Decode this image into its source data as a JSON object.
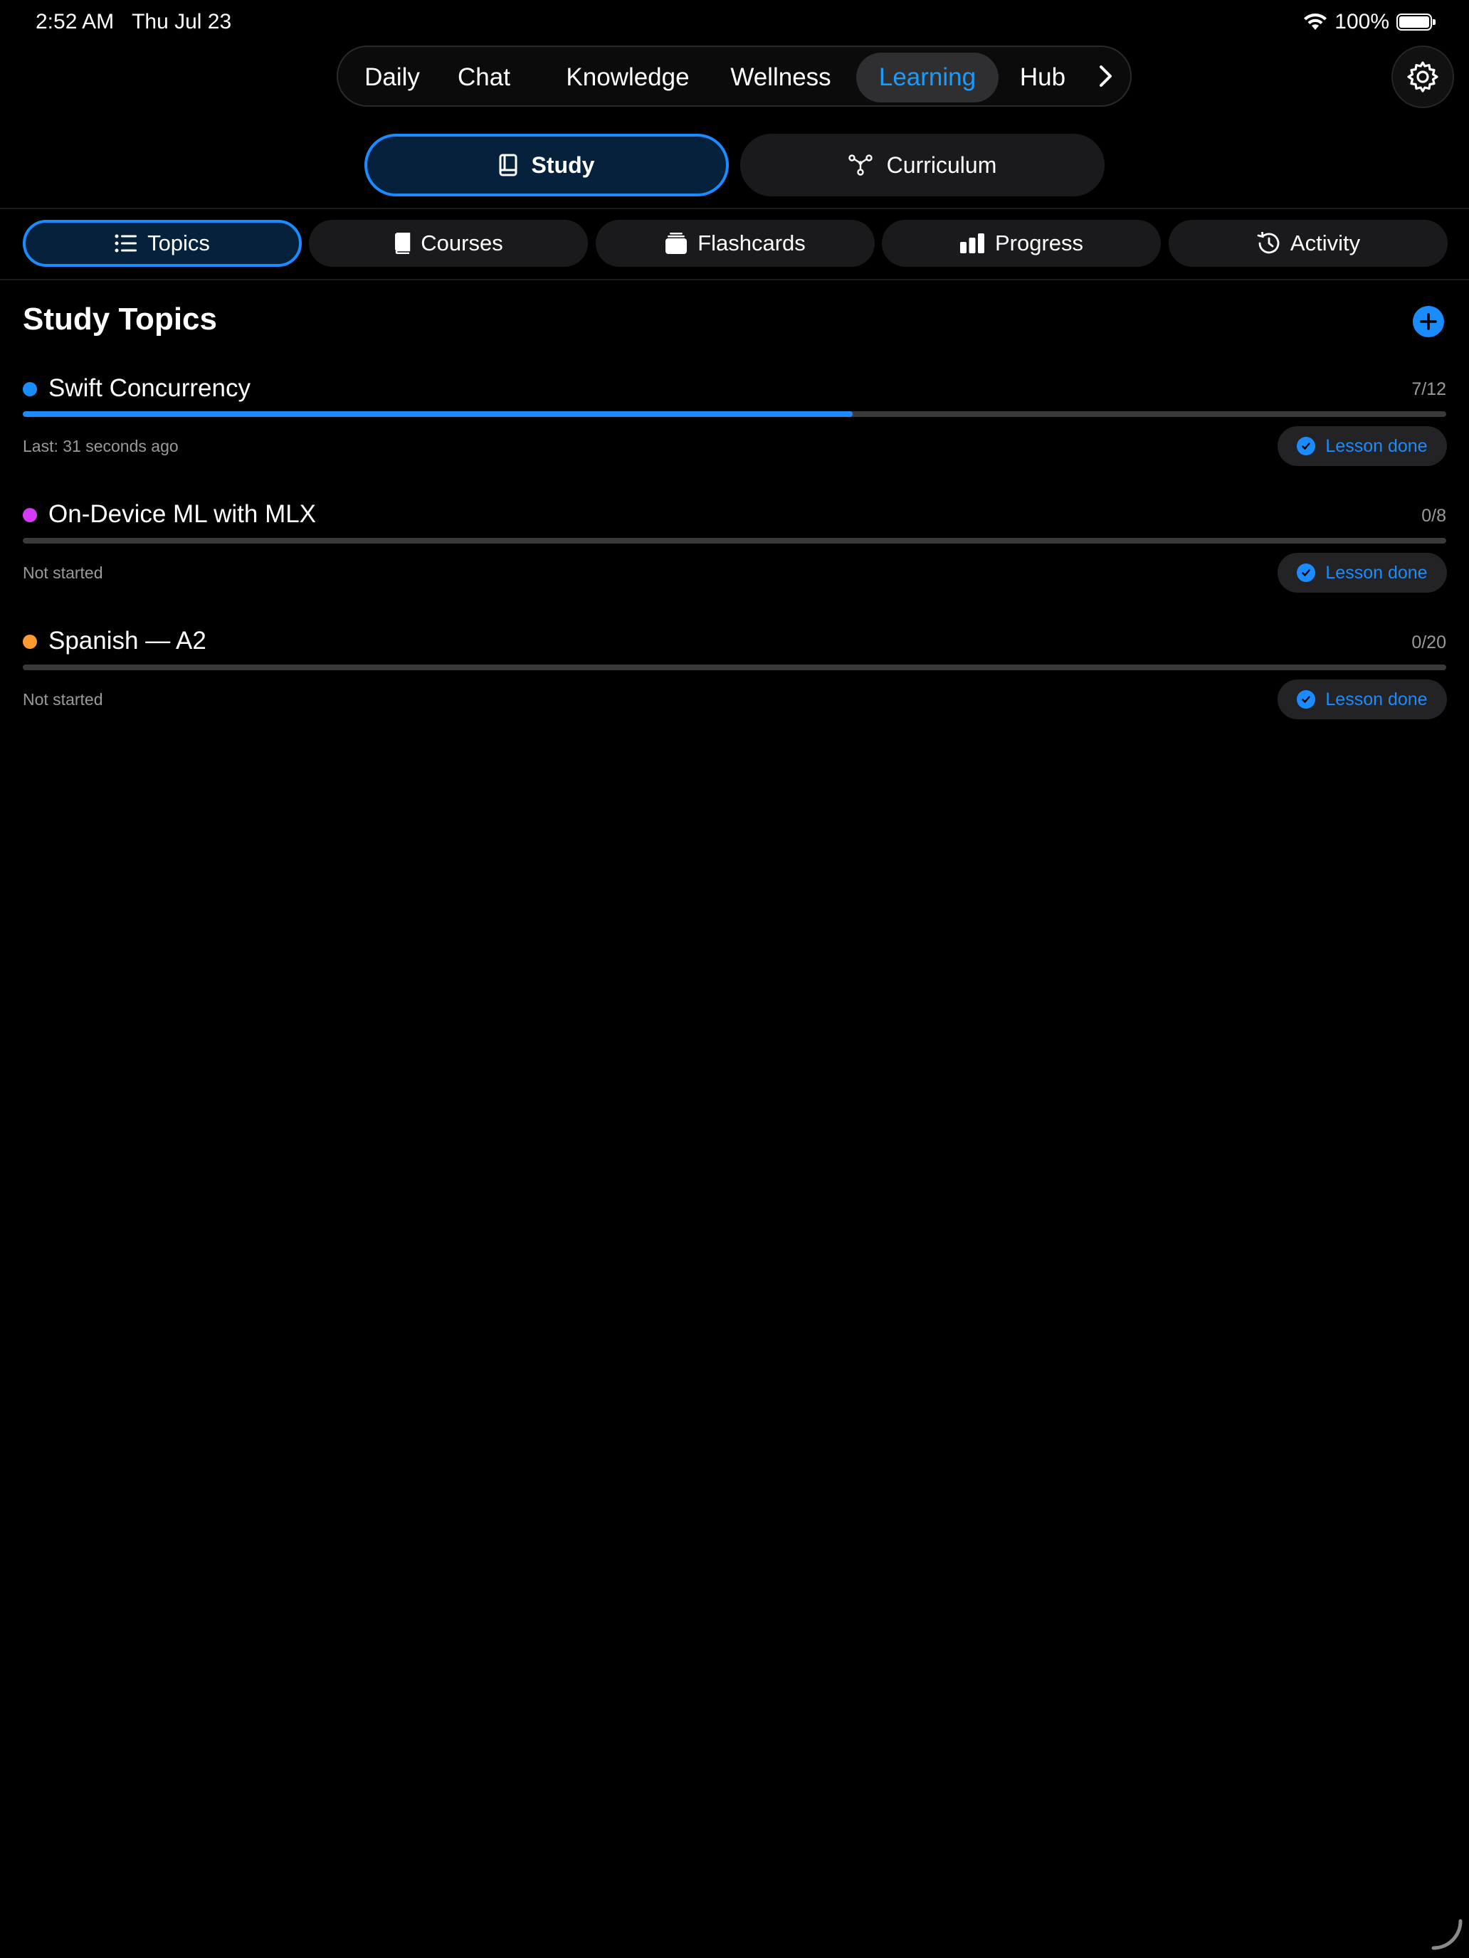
{
  "status": {
    "time": "2:52 AM",
    "date": "Thu Jul 23",
    "battery": "100%"
  },
  "topnav": {
    "tabs": [
      {
        "label": "Daily"
      },
      {
        "label": "Chat"
      },
      {
        "label": "Knowledge"
      },
      {
        "label": "Wellness"
      },
      {
        "label": "Learning",
        "active": true
      },
      {
        "label": "Hub"
      }
    ]
  },
  "segment": {
    "study": "Study",
    "curriculum": "Curriculum",
    "selected": "Study"
  },
  "subtabs": {
    "topics": "Topics",
    "courses": "Courses",
    "flashcards": "Flashcards",
    "progress": "Progress",
    "activity": "Activity",
    "selected": "Topics"
  },
  "section": {
    "title": "Study Topics"
  },
  "topics": [
    {
      "title": "Swift Concurrency",
      "count": "7/12",
      "progress": 0.583,
      "status": "Last: 31 seconds ago",
      "action": "Lesson done",
      "color": "#1a8cff"
    },
    {
      "title": "On-Device ML with MLX",
      "count": "0/8",
      "progress": 0,
      "status": "Not started",
      "action": "Lesson done",
      "color": "#d63af9"
    },
    {
      "title": "Spanish — A2",
      "count": "0/20",
      "progress": 0,
      "status": "Not started",
      "action": "Lesson done",
      "color": "#ff9a2e"
    }
  ],
  "colors": {
    "accent": "#1a8cff",
    "background": "#000000"
  }
}
